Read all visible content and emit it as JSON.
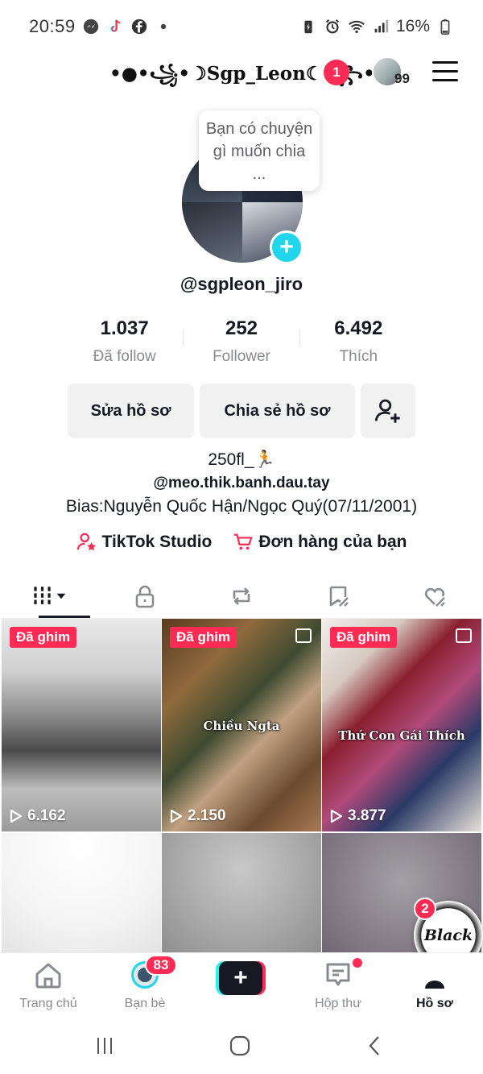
{
  "status_bar": {
    "time": "20:59",
    "battery": "16%",
    "left_icons": [
      "messenger-icon",
      "tiktok-icon",
      "facebook-icon",
      "dot-icon"
    ],
    "right_icons": [
      "battery-saver-icon",
      "alarm-icon",
      "wifi-icon",
      "signal-icon",
      "battery-icon"
    ]
  },
  "header": {
    "display_name": "•●•꧁•☽Sgp_Leon☾•꧂•●•",
    "notification_count": "1",
    "account_count": "99"
  },
  "profile": {
    "note_bubble": "Bạn có chuyện gì muốn chia ...",
    "username": "@sgpleon_jiro",
    "stats": [
      {
        "value": "1.037",
        "label": "Đã follow"
      },
      {
        "value": "252",
        "label": "Follower"
      },
      {
        "value": "6.492",
        "label": "Thích"
      }
    ],
    "buttons": {
      "edit": "Sửa hồ sơ",
      "share": "Chia sẻ hồ sơ"
    },
    "bio": {
      "line1": "250fl_🏃",
      "line2": "@meo.thik.banh.dau.tay",
      "line3": "Bias:Nguyễn Quốc Hận/Ngọc Quý(07/11/2001)"
    },
    "links": {
      "studio": "TikTok Studio",
      "orders": "Đơn hàng của bạn"
    }
  },
  "tabs": [
    "videos-grid-icon",
    "lock-icon",
    "repost-icon",
    "favorites-icon",
    "liked-icon"
  ],
  "videos": [
    {
      "pinned": "Đã ghim",
      "views": "6.162",
      "caption": ""
    },
    {
      "pinned": "Đã ghim",
      "views": "2.150",
      "caption": "Chiều Ngta"
    },
    {
      "pinned": "Đã ghim",
      "views": "3.877",
      "caption": "Thứ Con Gái Thích"
    }
  ],
  "floating_bubble": {
    "text": "Black",
    "badge": "2"
  },
  "bottom_nav": {
    "home": "Trang chủ",
    "friends": "Bạn bè",
    "friends_badge": "83",
    "inbox": "Hộp thư",
    "profile": "Hồ sơ"
  },
  "colors": {
    "accent_red": "#fe2c55",
    "accent_cyan": "#20d5ec",
    "text_primary": "#161823",
    "text_secondary": "#8a8b91"
  }
}
